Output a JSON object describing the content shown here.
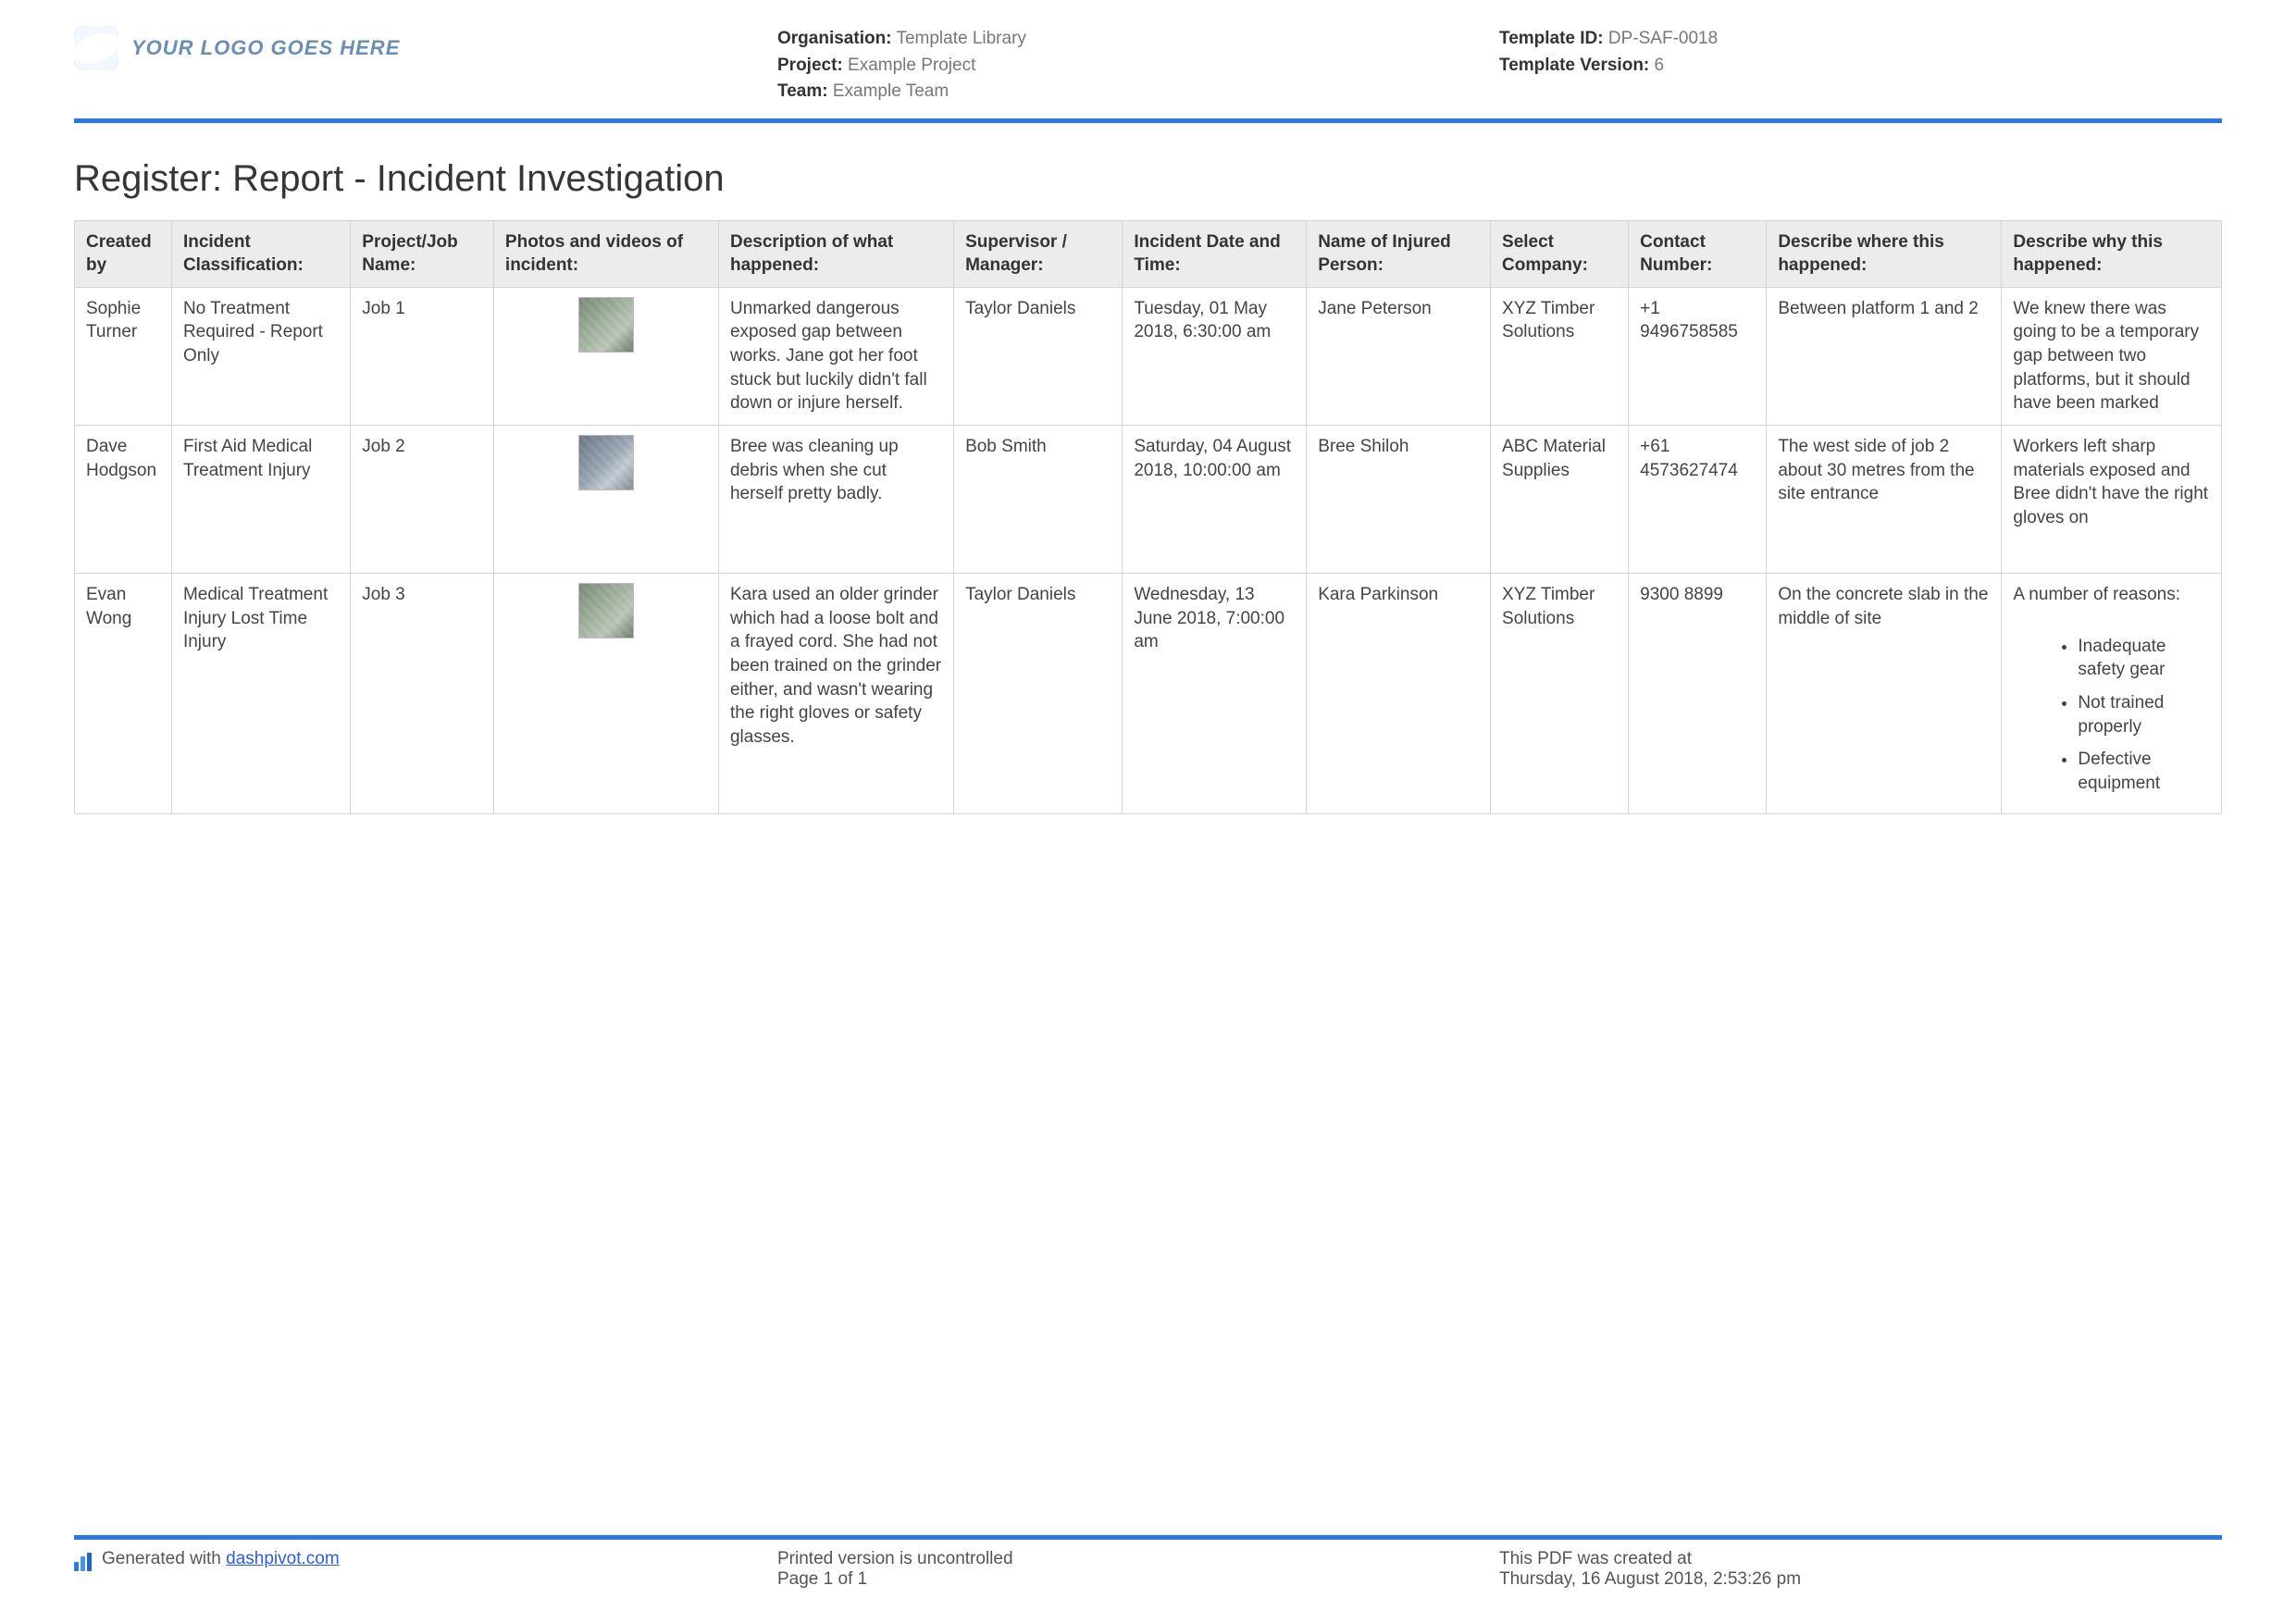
{
  "header": {
    "logo_text": "YOUR LOGO GOES HERE",
    "mid": {
      "org_label": "Organisation:",
      "org_value": "Template Library",
      "project_label": "Project:",
      "project_value": "Example Project",
      "team_label": "Team:",
      "team_value": "Example Team"
    },
    "right": {
      "tid_label": "Template ID:",
      "tid_value": "DP-SAF-0018",
      "tver_label": "Template Version:",
      "tver_value": "6"
    }
  },
  "title": "Register: Report - Incident Investigation",
  "columns": [
    "Created by",
    "Incident Classification:",
    "Project/Job Name:",
    "Photos and videos of incident:",
    "Description of what happened:",
    "Supervisor / Manager:",
    "Incident Date and Time:",
    "Name of Injured Person:",
    "Select Company:",
    "Contact Number:",
    "Describe where this happened:",
    "Describe why this happened:"
  ],
  "rows": [
    {
      "created_by": "Sophie Turner",
      "classification": "No Treatment Required - Report Only",
      "job": "Job 1",
      "description": "Unmarked dangerous exposed gap between works. Jane got her foot stuck but luckily didn't fall down or injure herself.",
      "supervisor": "Taylor Daniels",
      "date": "Tuesday, 01 May 2018, 6:30:00 am",
      "injured": "Jane Peterson",
      "company": "XYZ Timber Solutions",
      "contact": "+1 9496758585",
      "where": "Between platform 1 and 2",
      "why": "We knew there was going to be a temporary gap between two platforms, but it should have been marked",
      "why_list": []
    },
    {
      "created_by": "Dave Hodgson",
      "classification": "First Aid    Medical Treatment Injury",
      "job": "Job 2",
      "description": "Bree was cleaning up debris when she cut herself pretty badly.",
      "supervisor": "Bob Smith",
      "date": "Saturday, 04 August 2018, 10:00:00 am",
      "injured": "Bree Shiloh",
      "company": "ABC Material Supplies",
      "contact": "+61 4573627474",
      "where": "The west side of job 2 about 30 metres from the site entrance",
      "why": "Workers left sharp materials exposed and Bree didn't have the right gloves on",
      "why_list": []
    },
    {
      "created_by": "Evan Wong",
      "classification": "Medical Treatment Injury    Lost Time Injury",
      "job": "Job 3",
      "description": "Kara used an older grinder which had a loose bolt and a frayed cord. She had not been trained on the grinder either, and wasn't wearing the right gloves or safety glasses.",
      "supervisor": "Taylor Daniels",
      "date": "Wednesday, 13 June 2018, 7:00:00 am",
      "injured": "Kara Parkinson",
      "company": "XYZ Timber Solutions",
      "contact": "9300 8899",
      "where": "On the concrete slab in the middle of site",
      "why": "A number of reasons:",
      "why_list": [
        "Inadequate safety gear",
        "Not trained properly",
        "Defective equipment"
      ]
    }
  ],
  "footer": {
    "gen_prefix": "Generated with ",
    "gen_link": "dashpivot.com",
    "mid_line1": "Printed version is uncontrolled",
    "mid_line2": "Page 1 of 1",
    "right_line1": "This PDF was created at",
    "right_line2": "Thursday, 16 August 2018, 2:53:26 pm"
  }
}
